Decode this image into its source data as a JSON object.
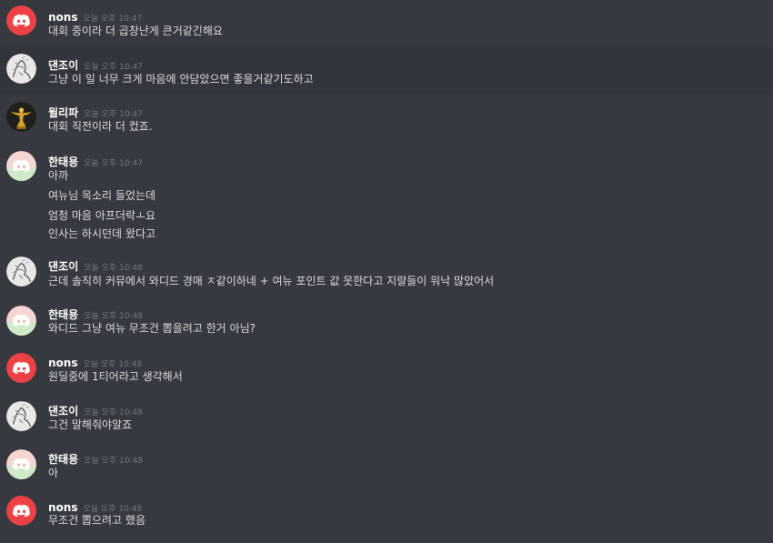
{
  "colors": {
    "background": "#36393f",
    "text": "#dcddde",
    "username": "#ffffff",
    "timestamp": "#72767d",
    "discord_red": "#ed4245",
    "highlight_row": "#32353b"
  },
  "messages": [
    {
      "author": "nons",
      "time": "오늘 오후 10:47",
      "avatar_icon": "discord-logo-red-icon",
      "lines": [
        "대회 중이라 더 곱창난게 큰거같긴해요"
      ]
    },
    {
      "author": "댄조이",
      "time": "오늘 오후 10:47",
      "avatar_icon": "sketch-avatar-icon",
      "lines": [
        "그냥 이 일 너무 크게 마음에 안담았으면 좋을거같기도하고"
      ]
    },
    {
      "author": "윌리파",
      "time": "오늘 오후 10:47",
      "avatar_icon": "golden-figure-avatar-icon",
      "lines": [
        "대회 직전이라 더 컸죠."
      ]
    },
    {
      "author": "한태용",
      "time": "오늘 오후 10:47",
      "avatar_icon": "discord-logo-pink-icon",
      "lines": [
        "아까",
        "여뉴님 목소리 들었는데",
        "엄청 마음 아프더락ㅗ요",
        "인사는 하시던데 왔다고"
      ]
    },
    {
      "author": "댄조이",
      "time": "오늘 오후 10:48",
      "avatar_icon": "sketch-avatar-icon",
      "lines": [
        "근데 솔직히 커뮤에서 와디드 경매 ㅈ같이하네 + 여뉴 포인트 값 못한다고 지랄들이 워낙 많았어서"
      ]
    },
    {
      "author": "한태용",
      "time": "오늘 오후 10:48",
      "avatar_icon": "discord-logo-pink-icon",
      "lines": [
        "와디드 그냥 여뉴 무조건 뽑을려고 한거 아님?"
      ]
    },
    {
      "author": "nons",
      "time": "오늘 오후 10:48",
      "avatar_icon": "discord-logo-red-icon",
      "lines": [
        "원딜중에 1티어라고 생각해서"
      ]
    },
    {
      "author": "댄조이",
      "time": "오늘 오후 10:48",
      "avatar_icon": "sketch-avatar-icon",
      "lines": [
        "그건 말해줘야알죠"
      ]
    },
    {
      "author": "한태용",
      "time": "오늘 오후 10:48",
      "avatar_icon": "discord-logo-pink-icon",
      "lines": [
        "아"
      ]
    },
    {
      "author": "nons",
      "time": "오늘 오후 10:48",
      "avatar_icon": "discord-logo-red-icon",
      "lines": [
        "무조건 뽑으려고 했음"
      ]
    }
  ]
}
